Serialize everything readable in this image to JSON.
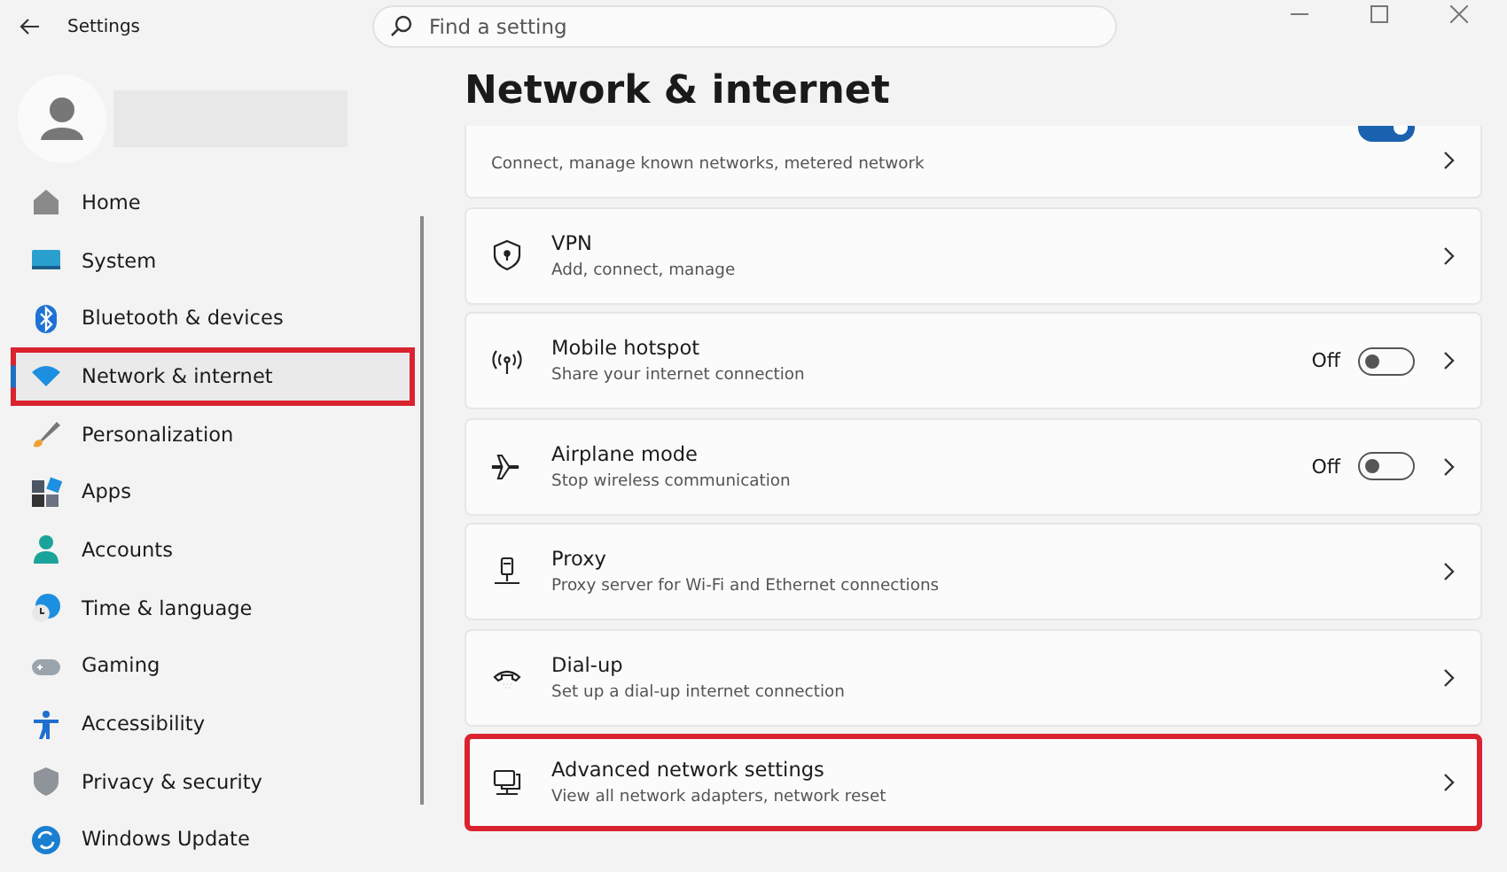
{
  "window": {
    "title": "Settings"
  },
  "search": {
    "placeholder": "Find a setting"
  },
  "page_title": "Network & internet",
  "sidebar": {
    "items": [
      {
        "label": "Home",
        "selected": false,
        "highlighted": false
      },
      {
        "label": "System",
        "selected": false,
        "highlighted": false
      },
      {
        "label": "Bluetooth & devices",
        "selected": false,
        "highlighted": false
      },
      {
        "label": "Network & internet",
        "selected": true,
        "highlighted": true
      },
      {
        "label": "Personalization",
        "selected": false,
        "highlighted": false
      },
      {
        "label": "Apps",
        "selected": false,
        "highlighted": false
      },
      {
        "label": "Accounts",
        "selected": false,
        "highlighted": false
      },
      {
        "label": "Time & language",
        "selected": false,
        "highlighted": false
      },
      {
        "label": "Gaming",
        "selected": false,
        "highlighted": false
      },
      {
        "label": "Accessibility",
        "selected": false,
        "highlighted": false
      },
      {
        "label": "Privacy & security",
        "selected": false,
        "highlighted": false
      },
      {
        "label": "Windows Update",
        "selected": false,
        "highlighted": false
      }
    ]
  },
  "cards": [
    {
      "kind": "partial",
      "description": "Connect, manage known networks, metered network",
      "toggle": {
        "on": true
      },
      "highlighted": false
    },
    {
      "kind": "link",
      "title": "VPN",
      "description": "Add, connect, manage",
      "highlighted": false
    },
    {
      "kind": "toggle",
      "title": "Mobile hotspot",
      "description": "Share your internet connection",
      "state_label": "Off",
      "toggle": {
        "on": false
      },
      "highlighted": false
    },
    {
      "kind": "toggle",
      "title": "Airplane mode",
      "description": "Stop wireless communication",
      "state_label": "Off",
      "toggle": {
        "on": false
      },
      "highlighted": false
    },
    {
      "kind": "link",
      "title": "Proxy",
      "description": "Proxy server for Wi-Fi and Ethernet connections",
      "highlighted": false
    },
    {
      "kind": "link",
      "title": "Dial-up",
      "description": "Set up a dial-up internet connection",
      "highlighted": false
    },
    {
      "kind": "link",
      "title": "Advanced network settings",
      "description": "View all network adapters, network reset",
      "highlighted": true
    }
  ]
}
